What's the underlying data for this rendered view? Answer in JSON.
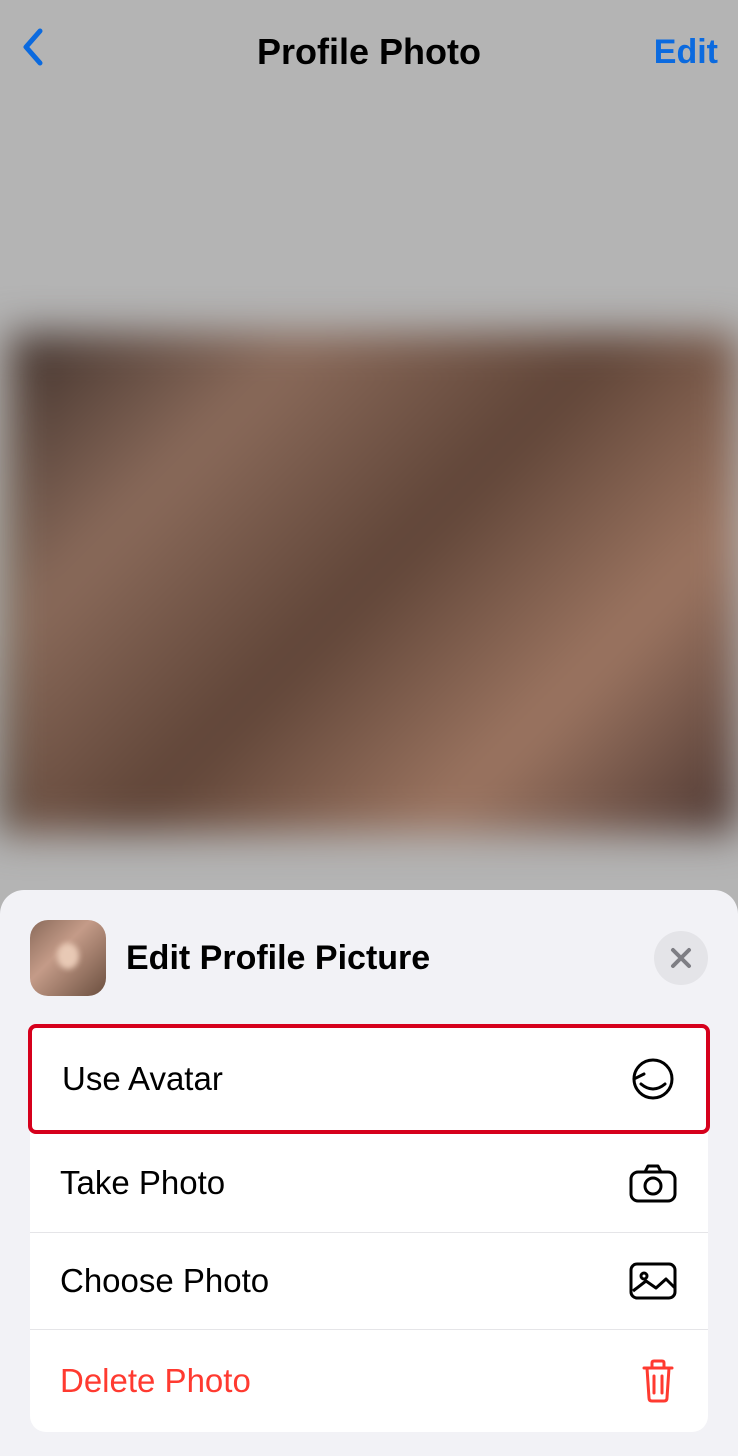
{
  "header": {
    "title": "Profile Photo",
    "edit_label": "Edit"
  },
  "sheet": {
    "title": "Edit Profile Picture",
    "options": {
      "use_avatar": "Use Avatar",
      "take_photo": "Take Photo",
      "choose_photo": "Choose Photo",
      "delete_photo": "Delete Photo"
    }
  }
}
